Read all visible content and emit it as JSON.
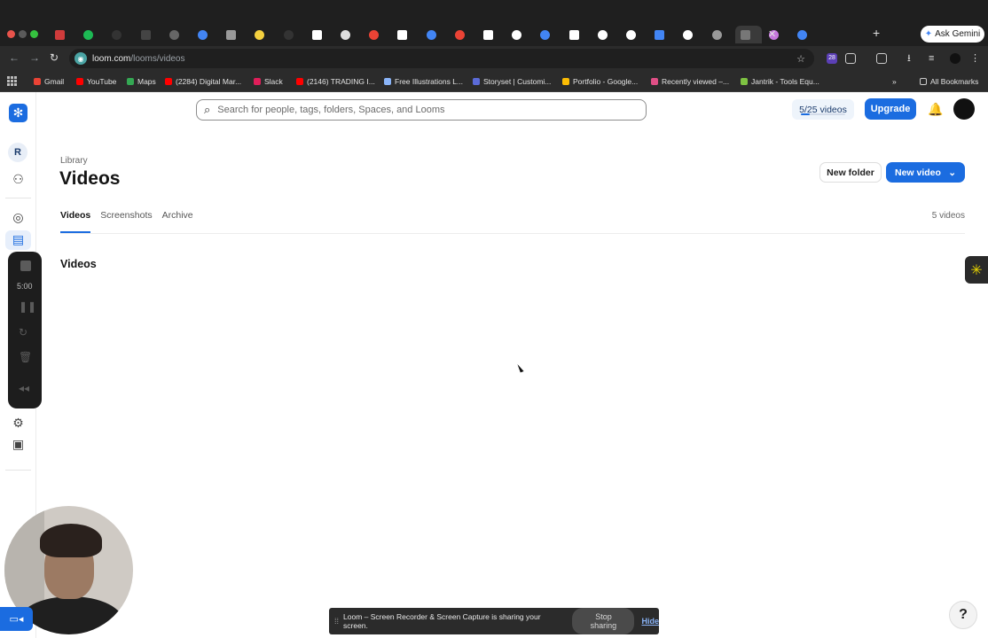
{
  "browser": {
    "url_domain": "loom.com",
    "url_path": "/looms/videos",
    "ask_gemini": "Ask Gemini",
    "extension_badge": "28",
    "tab_close": "✕",
    "new_tab": "+",
    "bookmarks": [
      {
        "label": "Gmail",
        "color": "#ea4335"
      },
      {
        "label": "YouTube",
        "color": "#ff0000"
      },
      {
        "label": "Maps",
        "color": "#34a853"
      },
      {
        "label": "(2284) Digital Mar...",
        "color": "#ff0000"
      },
      {
        "label": "Slack",
        "color": "#e01e5a"
      },
      {
        "label": "(2146) TRADING I...",
        "color": "#ff0000"
      },
      {
        "label": "Free Illustrations L...",
        "color": "#8ab4f8"
      },
      {
        "label": "Storyset | Customi...",
        "color": "#5b6bd8"
      },
      {
        "label": "Portfolio - Google...",
        "color": "#fbbc04"
      },
      {
        "label": "Recently viewed –...",
        "color": "#e04f86"
      },
      {
        "label": "Jantrik - Tools Equ...",
        "color": "#7ec242"
      }
    ],
    "all_bookmarks": "All Bookmarks"
  },
  "sidebar": {
    "avatar_initial": "R",
    "recorder_time": "5:00"
  },
  "header": {
    "search_placeholder": "Search for people, tags, folders, Spaces, and Looms",
    "quota_label": "5/25 videos",
    "quota_fraction": 0.2,
    "upgrade_label": "Upgrade"
  },
  "main": {
    "breadcrumb": "Library",
    "title": "Videos",
    "new_folder_label": "New folder",
    "new_video_label": "New video",
    "tabs": [
      {
        "label": "Videos",
        "active": true
      },
      {
        "label": "Screenshots",
        "active": false
      },
      {
        "label": "Archive",
        "active": false
      }
    ],
    "video_count": "5 videos",
    "section_title": "Videos"
  },
  "share_bar": {
    "message": "Loom – Screen Recorder & Screen Capture is sharing your screen.",
    "stop_label": "Stop sharing",
    "hide_label": "Hide"
  },
  "help_label": "?",
  "colors": {
    "accent": "#1b6ce0"
  }
}
